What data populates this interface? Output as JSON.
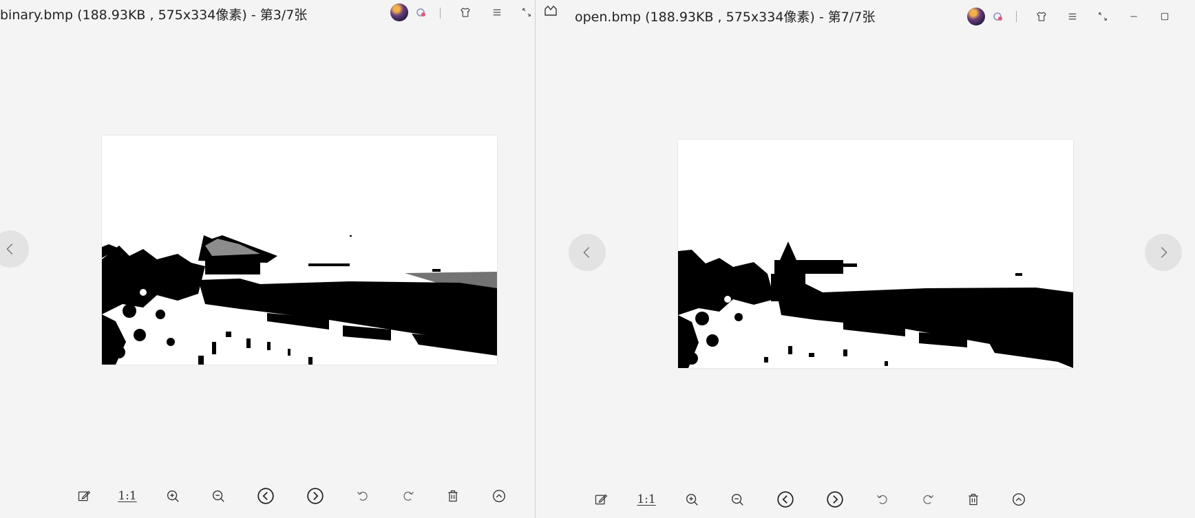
{
  "left_window": {
    "title": "binary.bmp (188.93KB , 575x334像素) - 第3/7张",
    "toolbar": {
      "actual_size_label": "1:1"
    }
  },
  "right_window": {
    "title": "open.bmp (188.93KB , 575x334像素) - 第7/7张",
    "toolbar": {
      "actual_size_label": "1:1"
    }
  },
  "icons": {
    "avatar": "avatar-icon",
    "badge": "badge-icon",
    "skin": "shirt-icon",
    "menu": "menu-icon",
    "fullscreen": "fullscreen-icon",
    "minimize": "minimize-icon",
    "maximize": "maximize-icon",
    "prev": "chevron-left-icon",
    "next": "chevron-right-icon",
    "edit": "edit-icon",
    "zoom_in": "zoom-in-icon",
    "zoom_out": "zoom-out-icon",
    "rotate_left": "rotate-left-icon",
    "rotate_right": "rotate-right-icon",
    "delete": "trash-icon",
    "expand": "chevron-up-circle-icon"
  },
  "colors": {
    "background": "#f4f4f4",
    "icon": "#444444",
    "nav_button": "#e3e3e3"
  }
}
